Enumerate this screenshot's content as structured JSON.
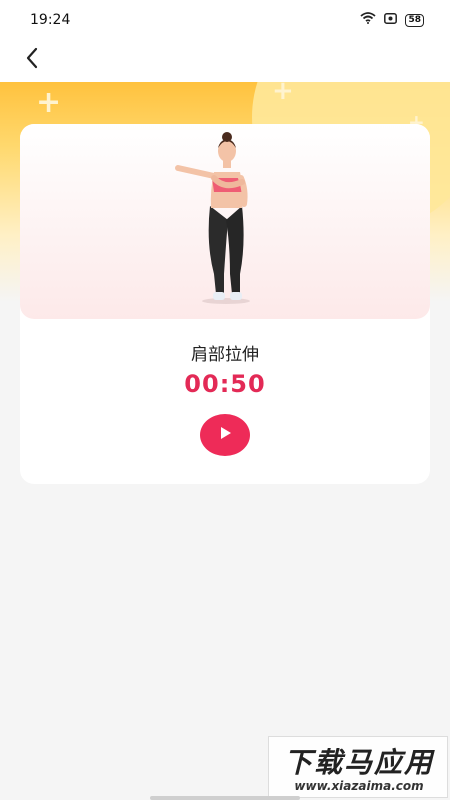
{
  "status_bar": {
    "time": "19:24",
    "battery": "58",
    "icons": [
      "wifi-icon",
      "screen-record-icon",
      "battery-icon"
    ]
  },
  "nav": {
    "back_icon": "chevron-left-icon"
  },
  "exercise": {
    "name": "肩部拉伸",
    "timer": "00:50",
    "play_icon": "play-icon"
  },
  "watermark": {
    "title": "下载马应用",
    "url": "www.xiazaima.com"
  },
  "colors": {
    "accent": "#e32a56",
    "banner_top": "#ffc23e",
    "background": "#f5f5f5"
  }
}
